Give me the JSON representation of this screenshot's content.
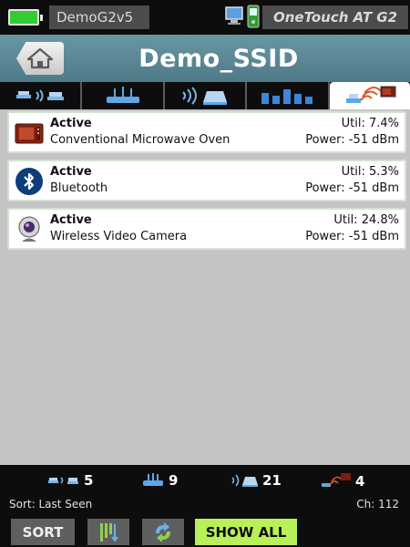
{
  "status_bar": {
    "battery_color": "#33cc33",
    "device_name": "DemoG2v5",
    "product_name": "OneTouch AT G2",
    "icons": [
      "pc-icon",
      "handheld-device-icon"
    ]
  },
  "header": {
    "title": "Demo_SSID",
    "home_icon": "home-icon",
    "background": "#5c8897"
  },
  "tabs": [
    {
      "name": "clients",
      "icon": "wireless-clients-icon",
      "active": false
    },
    {
      "name": "access-points",
      "icon": "access-point-icon",
      "active": false
    },
    {
      "name": "channels",
      "icon": "channel-signal-icon",
      "active": false
    },
    {
      "name": "channel-utilization",
      "icon": "bar-chart-icon",
      "active": false
    },
    {
      "name": "interferers",
      "icon": "interferer-icon",
      "active": true
    }
  ],
  "interferers": [
    {
      "status": "Active",
      "name": "Conventional Microwave Oven",
      "util": "Util: 7.4%",
      "power": "Power: -51 dBm",
      "icon": "microwave-oven-icon"
    },
    {
      "status": "Active",
      "name": "Bluetooth",
      "util": "Util: 5.3%",
      "power": "Power: -51 dBm",
      "icon": "bluetooth-icon"
    },
    {
      "status": "Active",
      "name": "Wireless Video Camera",
      "util": "Util: 24.8%",
      "power": "Power: -51 dBm",
      "icon": "video-camera-icon"
    }
  ],
  "footer": {
    "counts": [
      {
        "icon": "wireless-clients-icon",
        "value": "5"
      },
      {
        "icon": "access-point-icon",
        "value": "9"
      },
      {
        "icon": "channel-signal-icon",
        "value": "21"
      },
      {
        "icon": "interferer-icon",
        "value": "4"
      }
    ],
    "sort_text": "Sort: Last Seen",
    "channel_text": "Ch:  112",
    "buttons": {
      "sort": "SORT",
      "filter_icon": "filter-icon",
      "refresh_icon": "refresh-icon",
      "show_all": "SHOW ALL"
    },
    "show_all_color": "#b8f05a"
  }
}
